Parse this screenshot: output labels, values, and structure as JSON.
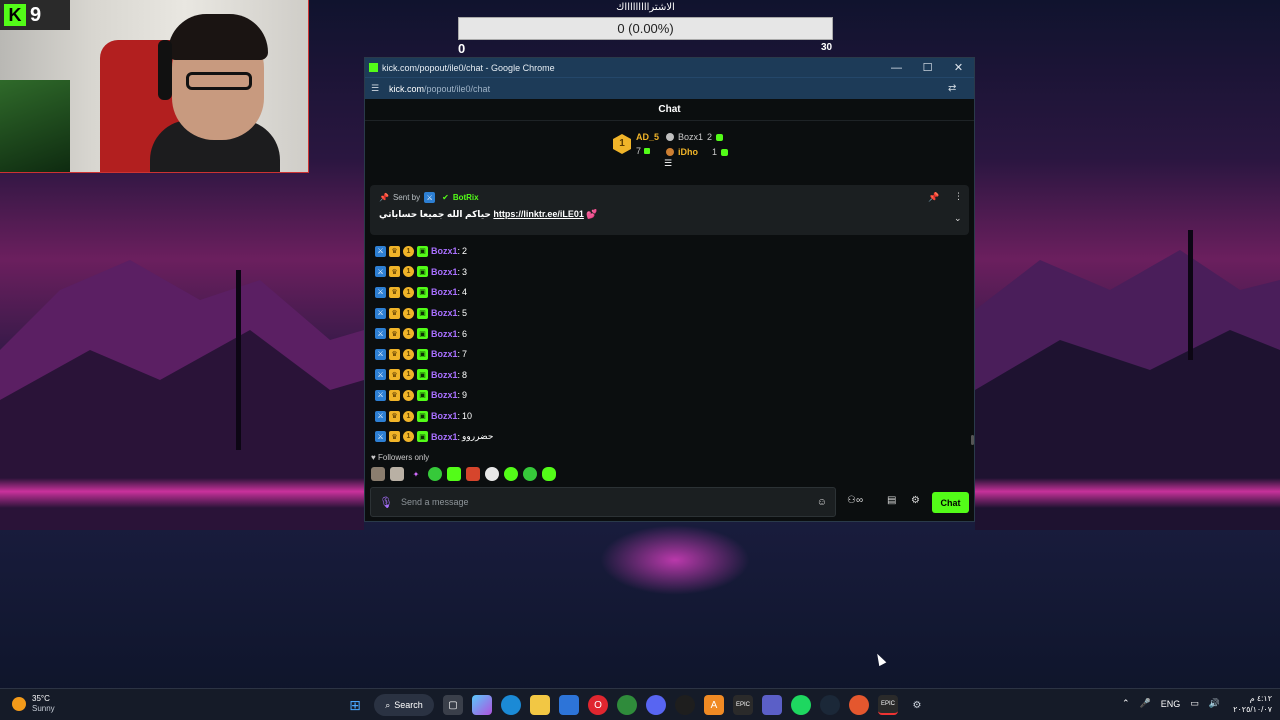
{
  "webcam": {
    "kick_count": "9"
  },
  "poll": {
    "title": "الاشتراااااااااك",
    "bar_text": "0 (0.00%)",
    "min": "0",
    "max": "30",
    "progress_fraction": 0
  },
  "window": {
    "title": "kick.com/popout/ile0/chat - Google Chrome",
    "url_host": "kick.com",
    "url_path": "/popout/ile0/chat",
    "controls": {
      "minimize": "—",
      "maximize": "☐",
      "close": "✕"
    }
  },
  "chat": {
    "header": "Chat",
    "leaderboard": {
      "first": {
        "rank": "1",
        "name": "AD_5",
        "value": "7"
      },
      "second": {
        "name": "Bozx1",
        "value": "2"
      },
      "third": {
        "name": "iDho",
        "value": "1"
      }
    },
    "pinned": {
      "sent_by_label": "Sent by",
      "bot_name": "BotRix",
      "message_text": "حياكم الله جميعا حساباتي",
      "link": "https://linktr.ee/iLE01",
      "emoji": "💕"
    },
    "messages": [
      {
        "user": "Bozx1",
        "text": "2"
      },
      {
        "user": "Bozx1",
        "text": "3"
      },
      {
        "user": "Bozx1",
        "text": "4"
      },
      {
        "user": "Bozx1",
        "text": "5"
      },
      {
        "user": "Bozx1",
        "text": "6"
      },
      {
        "user": "Bozx1",
        "text": "7"
      },
      {
        "user": "Bozx1",
        "text": "8"
      },
      {
        "user": "Bozx1",
        "text": "9"
      },
      {
        "user": "Bozx1",
        "text": "10"
      },
      {
        "user": "Bozx1",
        "text": "حضرروو"
      }
    ],
    "followers_only": "Followers only",
    "input_placeholder": "Send a message",
    "send_label": "Chat"
  },
  "taskbar": {
    "weather_temp": "35°C",
    "weather_cond": "Sunny",
    "search_label": "Search",
    "language": "ENG",
    "time": "٤:١٢ م",
    "date": "٢٠٢٥/١٠/٠٧"
  },
  "colors": {
    "kick_green": "#53fc18",
    "username_purple": "#a970ff",
    "gold": "#f0b429",
    "chrome_blue": "#1d3b58"
  }
}
